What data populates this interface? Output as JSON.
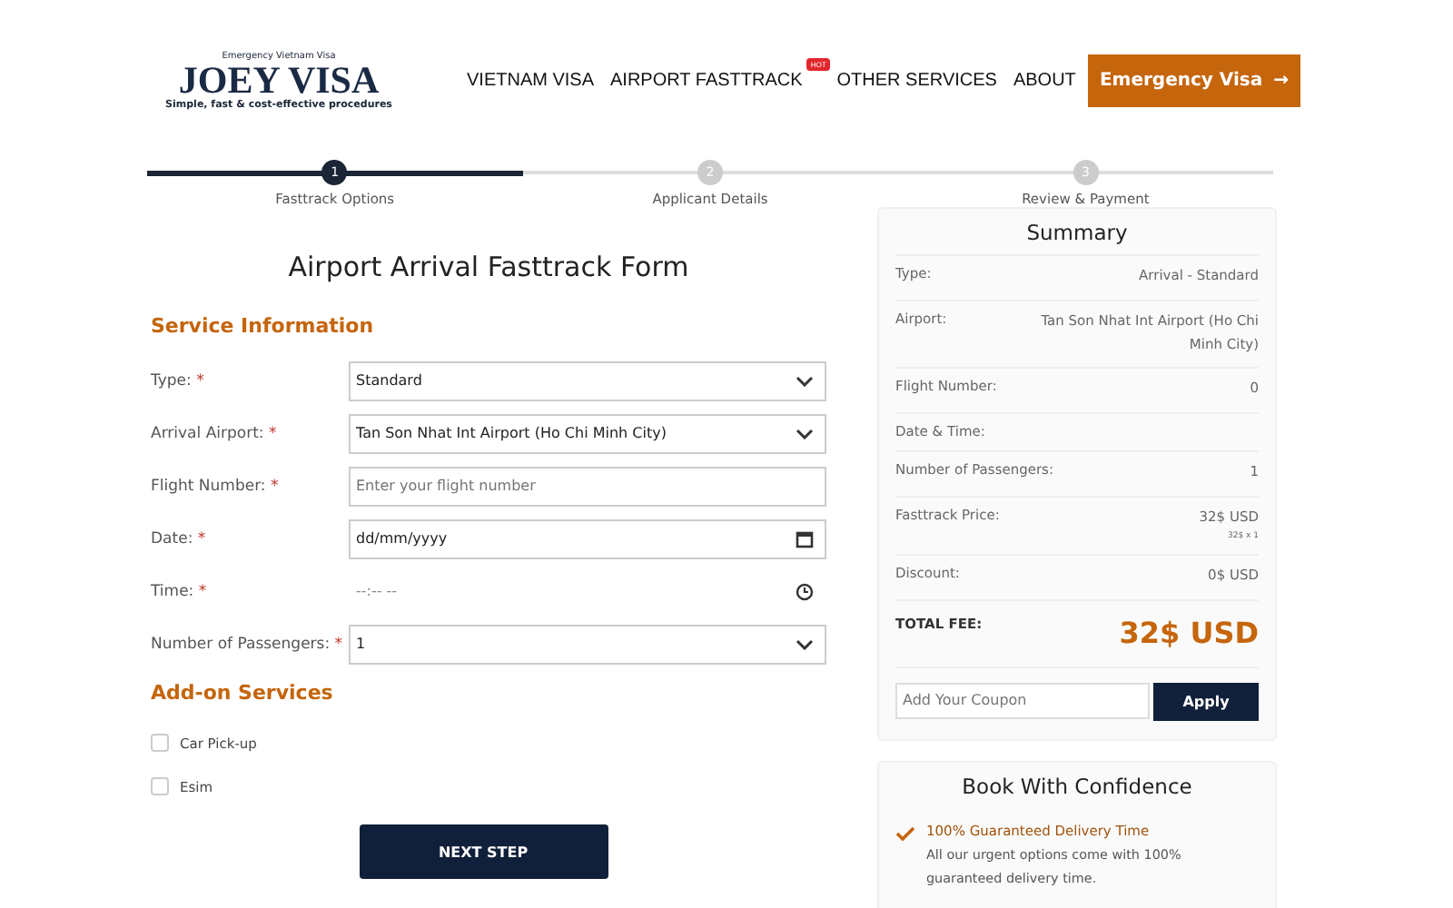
{
  "header": {
    "logo": {
      "tagline_top": "Emergency Vietnam Visa",
      "name": "JOEY VISA",
      "tagline_bottom": "Simple, fast & cost-effective procedures"
    },
    "nav": [
      {
        "label": "VIETNAM VISA"
      },
      {
        "label": "AIRPORT FASTTRACK",
        "badge": "HOT"
      },
      {
        "label": "OTHER SERVICES"
      },
      {
        "label": "ABOUT"
      }
    ],
    "cta": {
      "label": "Emergency Visa",
      "arrow": "→"
    }
  },
  "steps": [
    {
      "number": "1",
      "label": "Fasttrack Options",
      "selected": true
    },
    {
      "number": "2",
      "label": "Applicant Details",
      "selected": false
    },
    {
      "number": "3",
      "label": "Review & Payment",
      "selected": false
    }
  ],
  "form": {
    "title": "Airport Arrival Fasttrack Form",
    "section": "Service Information",
    "fields": [
      {
        "label": "Type:",
        "required": "*",
        "kind": "select",
        "value": "Standard"
      },
      {
        "label": "Arrival Airport:",
        "required": "*",
        "kind": "select",
        "value": "Tan Son Nhat Int Airport (Ho Chi Minh City)"
      },
      {
        "label": "Flight Number:",
        "required": "*",
        "kind": "text",
        "placeholder": "Enter your flight number"
      },
      {
        "label": "Date:",
        "required": "*",
        "kind": "date",
        "value": "dd/mm/yyyy"
      },
      {
        "label": "Time:",
        "required": "*",
        "kind": "time",
        "placeholder": "--:-- --"
      },
      {
        "label": "Number of Passengers:",
        "required": "*",
        "kind": "select",
        "value": "1"
      }
    ],
    "addons_title": "Add-on Services",
    "addons": [
      {
        "label": "Car Pick-up",
        "checked": false
      },
      {
        "label": "Esim",
        "checked": false
      }
    ],
    "submit": "NEXT STEP"
  },
  "summary": {
    "title": "Summary",
    "rows": [
      {
        "label": "Type:",
        "value": "Arrival - Standard"
      },
      {
        "label": "Airport:",
        "value": "Tan Son Nhat Int Airport (Ho Chi Minh City)"
      },
      {
        "label": "Flight Number:",
        "value": "0"
      },
      {
        "label": "Date & Time:"
      },
      {
        "label": "Number of Passengers:",
        "value": "1"
      },
      {
        "label": "Fasttrack Price:",
        "value": "32$ USD",
        "note": "32$ x 1"
      },
      {
        "label": "Discount:",
        "value": "0$ USD"
      }
    ],
    "total_label": "TOTAL FEE:",
    "total": "32$ USD",
    "coupon_placeholder": "Add Your Coupon",
    "apply": "Apply"
  },
  "confidence": {
    "title": "Book With Confidence",
    "items": [
      {
        "title": "100% Guaranteed Delivery Time",
        "text": "All our urgent options come with 100% guaranteed delivery time."
      }
    ]
  }
}
